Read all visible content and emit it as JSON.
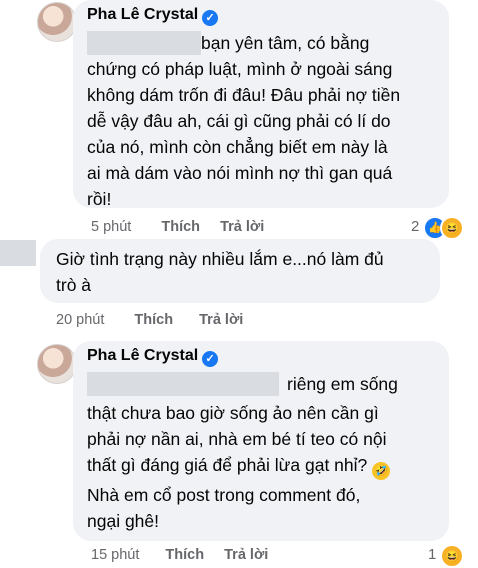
{
  "comment1": {
    "author": "Pha Lê Crystal",
    "verified_icon": "check",
    "text": "bạn yên tâm, có bằng\nchứng có pháp luật, mình ở ngoài sáng\nkhông dám trốn đi đâu! Đâu phải nợ tiền\ndễ vậy đâu ah, cái gì cũng phải có lí do\ncủa nó, mình còn chẳng biết em này là\nai mà dám vào nói mình nợ thì gan quá\nrồi!",
    "time": "5 phút",
    "like": "Thích",
    "reply": "Trả lời",
    "reaction_count": "2"
  },
  "comment2": {
    "text": "Giờ tình trạng này nhiều lắm e...nó làm đủ\ntrò à",
    "time": "20 phút",
    "like": "Thích",
    "reply": "Trả lời"
  },
  "comment3": {
    "author": "Pha Lê Crystal",
    "line1": "riêng em sống",
    "text": "thật chưa bao giờ sống ảo nên cần gì\nphải nợ nần ai, nhà em bé tí teo có nội\nthất gì đáng giá để phải lừa gạt nhỉ? ",
    "text2": "Nhà em cổ post trong comment đó,\nngại ghê!",
    "time": "15 phút",
    "like": "Thích",
    "reply": "Trả lời",
    "reaction_count": "1"
  },
  "icons": {
    "like_reaction": "like-icon",
    "haha_reaction": "haha-icon",
    "rofl_emoji": "rofl-emoji"
  },
  "colors": {
    "bubble": "#f0f2f5",
    "meta": "#65676b",
    "verified": "#1877f2"
  }
}
